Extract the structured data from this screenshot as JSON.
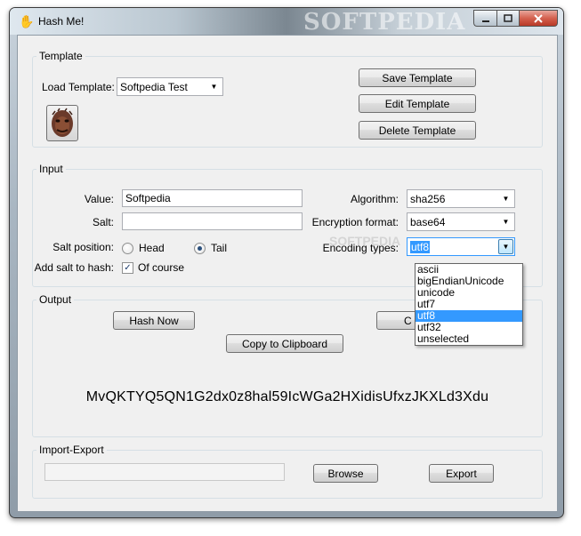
{
  "window": {
    "title": "Hash Me!",
    "watermark": "SOFTPEDIA"
  },
  "template": {
    "legend": "Template",
    "load_label": "Load Template:",
    "selected": "Softpedia Test",
    "save_button": "Save Template",
    "edit_button": "Edit Template",
    "delete_button": "Delete Template"
  },
  "input": {
    "legend": "Input",
    "value_label": "Value:",
    "value": "Softpedia",
    "salt_label": "Salt:",
    "salt": "",
    "salt_position_label": "Salt position:",
    "head_label": "Head",
    "tail_label": "Tail",
    "salt_position_selected": "Tail",
    "add_salt_label": "Add salt to hash:",
    "of_course_label": "Of course",
    "add_salt_checked": true,
    "algorithm_label": "Algorithm:",
    "algorithm": "sha256",
    "encryption_format_label": "Encryption format:",
    "encryption_format": "base64",
    "encoding_types_label": "Encoding types:",
    "encoding_type": "utf8",
    "encoding_options": [
      "ascii",
      "bigEndianUnicode",
      "unicode",
      "utf7",
      "utf8",
      "utf32",
      "unselected"
    ],
    "encoding_selected_index": 4
  },
  "output": {
    "legend": "Output",
    "hash_button": "Hash Now",
    "copy_button": "Copy to Clipboard",
    "hidden_button_fragment": "C",
    "hash_value": "MvQKTYQ5QN1G2dx0z8hal59IcWGa2HXidisUfxzJKXLd3Xdu"
  },
  "import_export": {
    "legend": "Import-Export",
    "path": "",
    "browse_button": "Browse",
    "export_button": "Export"
  }
}
